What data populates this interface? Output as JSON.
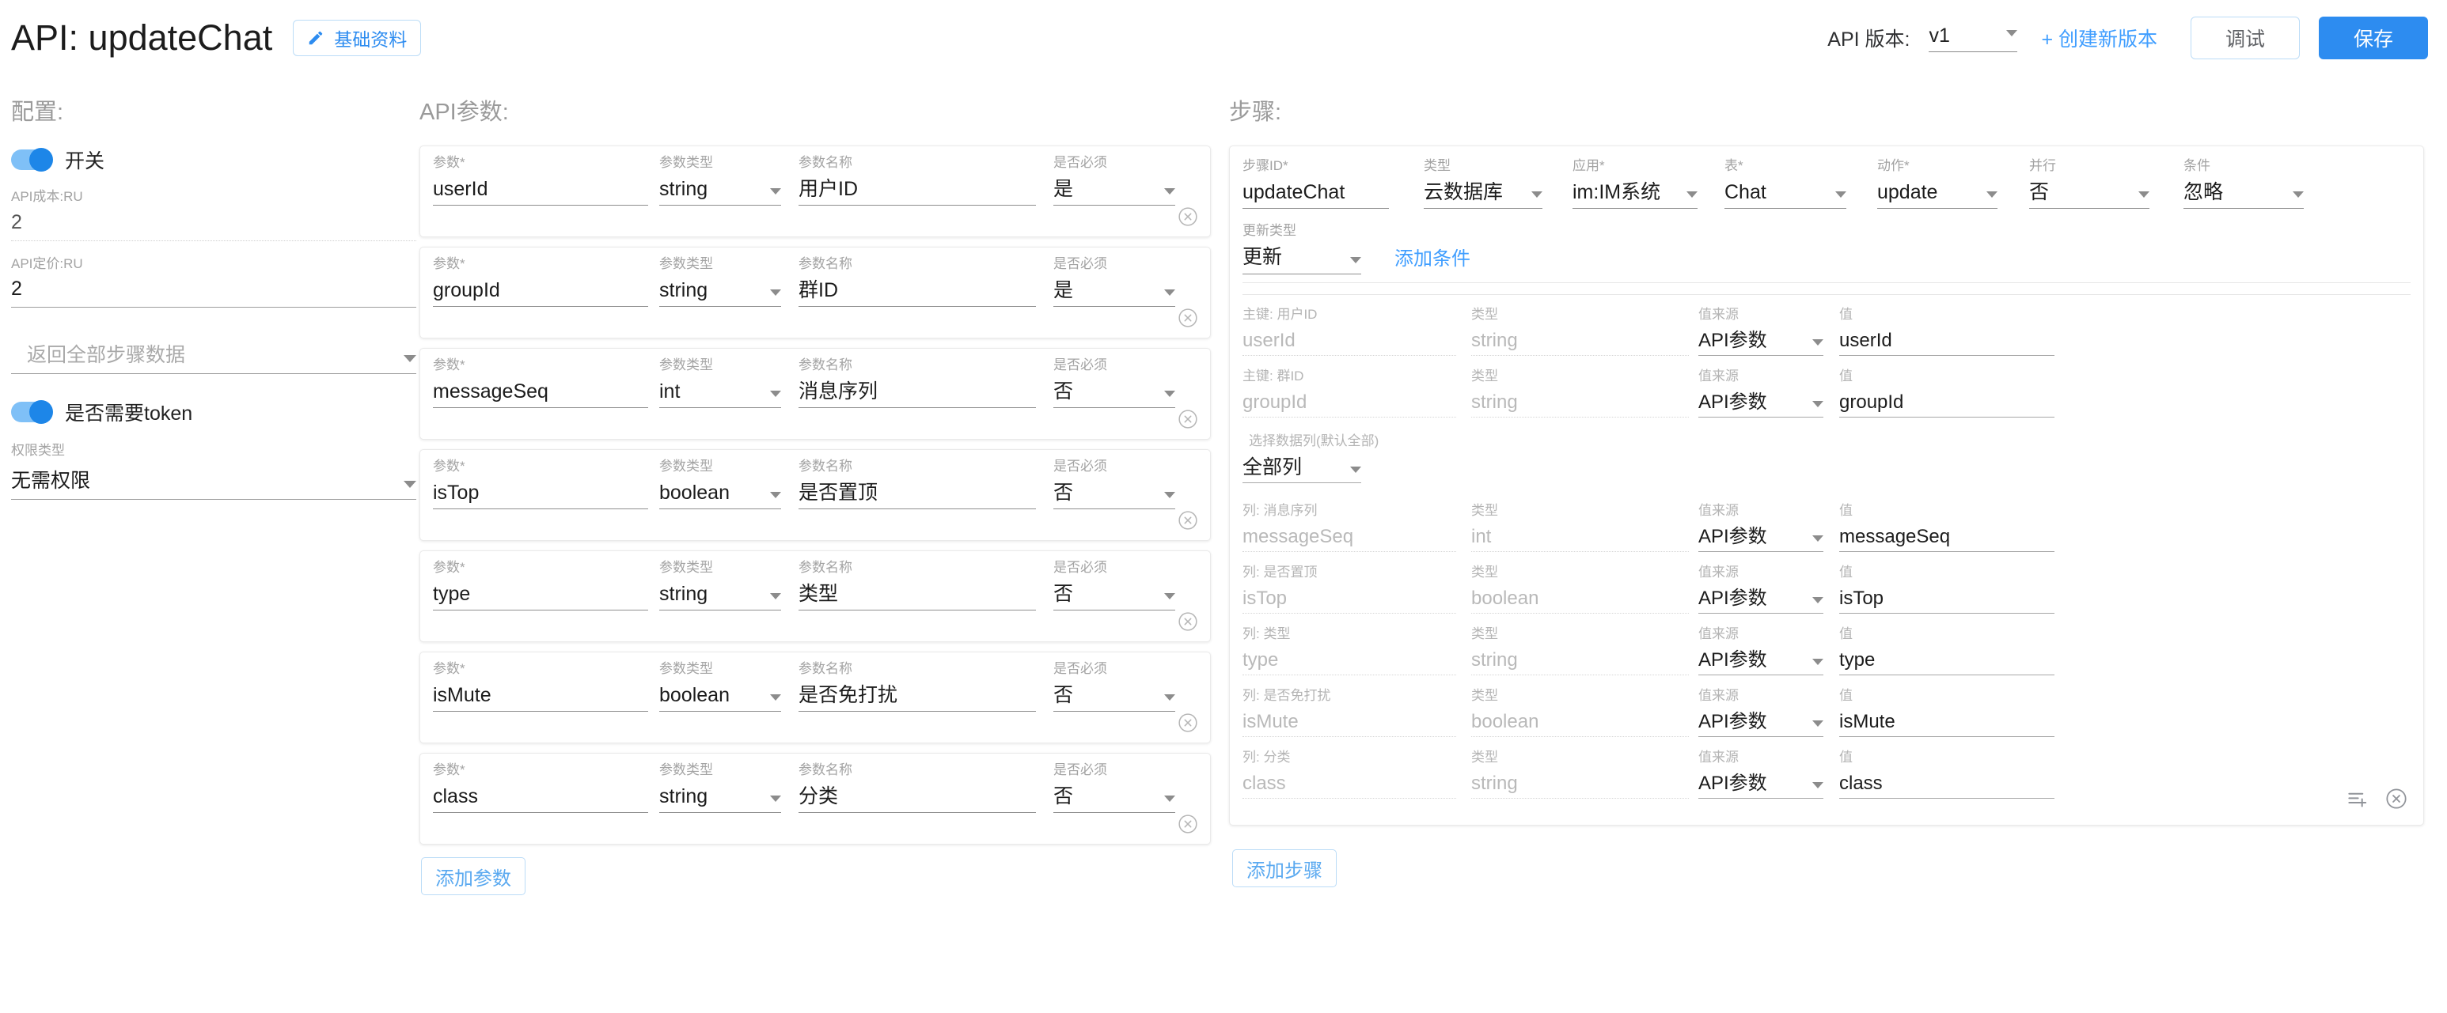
{
  "header": {
    "title": "API: updateChat",
    "basic_info_button": "基础资料",
    "pencil_icon": "pencil-icon",
    "api_version_label": "API 版本:",
    "version_value": "v1",
    "create_version_link": "+ 创建新版本",
    "debug_button": "调试",
    "save_button": "保存",
    "accent_color": "#2d8cf0",
    "link_color": "#409eff"
  },
  "config": {
    "section_title": "配置:",
    "switch_label": "开关",
    "switch_on": true,
    "cost_label": "API成本:RU",
    "cost_value": "2",
    "price_label": "API定价:RU",
    "price_value": "2",
    "return_select_placeholder": "返回全部步骤数据",
    "token_switch_label": "是否需要token",
    "token_switch_on": true,
    "permission_label": "权限类型",
    "permission_value": "无需权限"
  },
  "params": {
    "section_title": "API参数:",
    "columns": {
      "name": "参数",
      "type": "参数类型",
      "display_name": "参数名称",
      "required": "是否必须"
    },
    "required_marker": "*",
    "add_button": "添加参数",
    "rows": [
      {
        "name": "userId",
        "type": "string",
        "display_name": "用户ID",
        "required": "是"
      },
      {
        "name": "groupId",
        "type": "string",
        "display_name": "群ID",
        "required": "是"
      },
      {
        "name": "messageSeq",
        "type": "int",
        "display_name": "消息序列",
        "required": "否"
      },
      {
        "name": "isTop",
        "type": "boolean",
        "display_name": "是否置顶",
        "required": "否"
      },
      {
        "name": "type",
        "type": "string",
        "display_name": "类型",
        "required": "否"
      },
      {
        "name": "isMute",
        "type": "boolean",
        "display_name": "是否免打扰",
        "required": "否"
      },
      {
        "name": "class",
        "type": "string",
        "display_name": "分类",
        "required": "否"
      }
    ]
  },
  "steps": {
    "section_title": "步骤:",
    "add_button": "添加步骤",
    "head_labels": {
      "step_id": "步骤ID",
      "type": "类型",
      "app": "应用",
      "table": "表",
      "action": "动作",
      "parallel": "并行",
      "condition": "条件"
    },
    "head_values": {
      "step_id": "updateChat",
      "type": "云数据库",
      "app": "im:IM系统",
      "table": "Chat",
      "action": "update",
      "parallel": "否",
      "condition": "忽略"
    },
    "update_type_label": "更新类型",
    "update_type_value": "更新",
    "add_condition_link": "添加条件",
    "column_select_label": "选择数据列(默认全部)",
    "column_select_value": "全部列",
    "map_labels": {
      "type": "类型",
      "source": "值来源",
      "value": "值"
    },
    "primary_keys": [
      {
        "label": "主键: 用户ID",
        "field": "userId",
        "type": "string",
        "source": "API参数",
        "value": "userId"
      },
      {
        "label": "主键: 群ID",
        "field": "groupId",
        "type": "string",
        "source": "API参数",
        "value": "groupId"
      }
    ],
    "columns": [
      {
        "label": "列: 消息序列",
        "field": "messageSeq",
        "type": "int",
        "source": "API参数",
        "value": "messageSeq"
      },
      {
        "label": "列: 是否置顶",
        "field": "isTop",
        "type": "boolean",
        "source": "API参数",
        "value": "isTop"
      },
      {
        "label": "列: 类型",
        "field": "type",
        "type": "string",
        "source": "API参数",
        "value": "type"
      },
      {
        "label": "列: 是否免打扰",
        "field": "isMute",
        "type": "boolean",
        "source": "API参数",
        "value": "isMute"
      },
      {
        "label": "列: 分类",
        "field": "class",
        "type": "string",
        "source": "API参数",
        "value": "class"
      }
    ],
    "tool_icons": [
      "add-list-icon",
      "remove-step-icon"
    ]
  }
}
